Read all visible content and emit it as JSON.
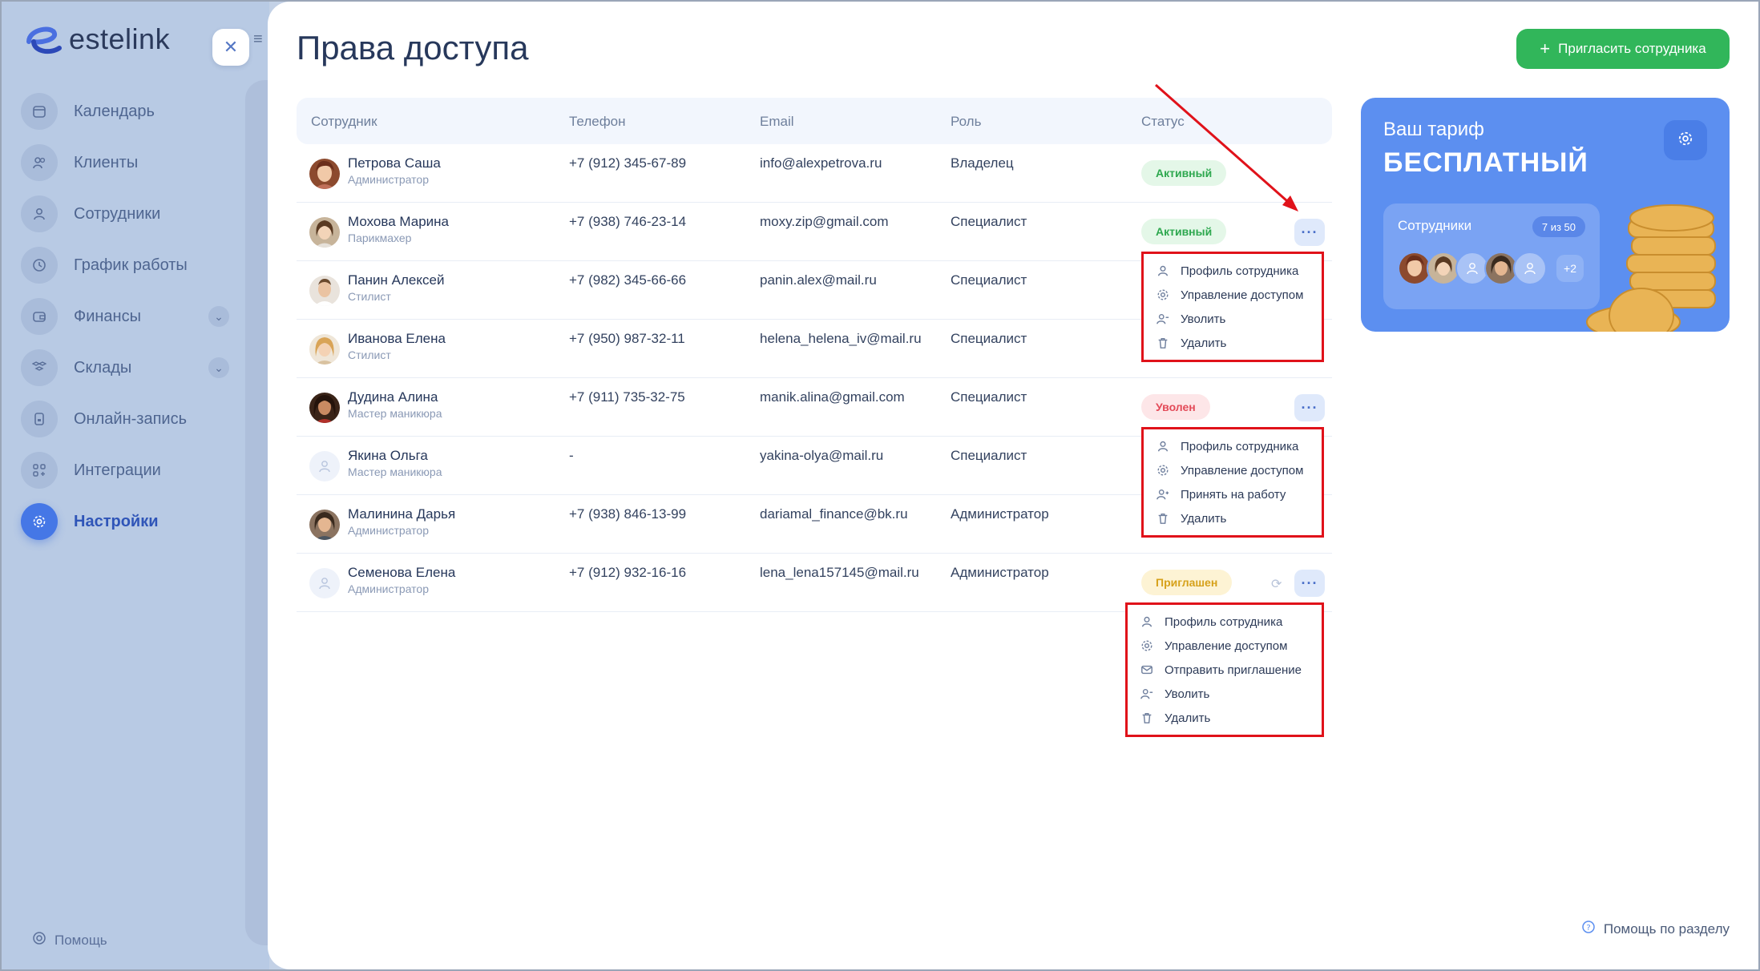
{
  "brand": {
    "name": "estelink"
  },
  "sidebar": {
    "items": [
      {
        "label": "Календарь",
        "icon": "calendar-icon"
      },
      {
        "label": "Клиенты",
        "icon": "clients-icon"
      },
      {
        "label": "Сотрудники",
        "icon": "user-icon"
      },
      {
        "label": "График работы",
        "icon": "clock-icon"
      },
      {
        "label": "Финансы",
        "icon": "wallet-icon",
        "expandable": true
      },
      {
        "label": "Склады",
        "icon": "boxes-icon",
        "expandable": true
      },
      {
        "label": "Онлайн-запись",
        "icon": "phone-icon"
      },
      {
        "label": "Интеграции",
        "icon": "integrations-icon"
      },
      {
        "label": "Настройки",
        "icon": "gear-icon",
        "active": true
      }
    ],
    "help": "Помощь"
  },
  "page": {
    "title": "Права доступа",
    "invite_button": "Пригласить сотрудника",
    "help_section": "Помощь по разделу"
  },
  "table": {
    "headers": {
      "employee": "Сотрудник",
      "phone": "Телефон",
      "email": "Email",
      "role": "Роль",
      "status": "Статус"
    },
    "rows": [
      {
        "name": "Петрова Саша",
        "position": "Администратор",
        "phone": "+7 (912) 345-67-89",
        "email": "info@alexpetrova.ru",
        "role": "Владелец",
        "status": "Активный",
        "status_type": "active"
      },
      {
        "name": "Мохова Марина",
        "position": "Парикмахер",
        "phone": "+7 (938) 746-23-14",
        "email": "moxy.zip@gmail.com",
        "role": "Специалист",
        "status": "Активный",
        "status_type": "active"
      },
      {
        "name": "Панин Алексей",
        "position": "Стилист",
        "phone": "+7 (982) 345-66-66",
        "email": "panin.alex@mail.ru",
        "role": "Специалист",
        "status": "",
        "status_type": ""
      },
      {
        "name": "Иванова Елена",
        "position": "Стилист",
        "phone": "+7 (950) 987-32-11",
        "email": "helena_helena_iv@mail.ru",
        "role": "Специалист",
        "status": "",
        "status_type": ""
      },
      {
        "name": "Дудина Алина",
        "position": "Мастер маникюра",
        "phone": "+7 (911) 735-32-75",
        "email": "manik.alina@gmail.com",
        "role": "Специалист",
        "status": "Уволен",
        "status_type": "fired"
      },
      {
        "name": "Якина Ольга",
        "position": "Мастер маникюра",
        "phone": "-",
        "email": "yakina-olya@mail.ru",
        "role": "Специалист",
        "status": "",
        "status_type": ""
      },
      {
        "name": "Малинина Дарья",
        "position": "Администратор",
        "phone": "+7 (938) 846-13-99",
        "email": "dariamal_finance@bk.ru",
        "role": "Администратор",
        "status": "",
        "status_type": ""
      },
      {
        "name": "Семенова Елена",
        "position": "Администратор",
        "phone": "+7 (912) 932-16-16",
        "email": "lena_lena157145@mail.ru",
        "role": "Администратор",
        "status": "Приглашен",
        "status_type": "invited"
      }
    ]
  },
  "menus": {
    "active": [
      {
        "label": "Профиль сотрудника",
        "icon": "user-icon"
      },
      {
        "label": "Управление доступом",
        "icon": "gear-icon"
      },
      {
        "label": "Уволить",
        "icon": "user-minus-icon"
      },
      {
        "label": "Удалить",
        "icon": "trash-icon"
      }
    ],
    "fired": [
      {
        "label": "Профиль сотрудника",
        "icon": "user-icon"
      },
      {
        "label": "Управление доступом",
        "icon": "gear-icon"
      },
      {
        "label": "Принять на работу",
        "icon": "user-plus-icon"
      },
      {
        "label": "Удалить",
        "icon": "trash-icon"
      }
    ],
    "invited": [
      {
        "label": "Профиль сотрудника",
        "icon": "user-icon"
      },
      {
        "label": "Управление доступом",
        "icon": "gear-icon"
      },
      {
        "label": "Отправить приглашение",
        "icon": "mail-icon"
      },
      {
        "label": "Уволить",
        "icon": "user-minus-icon"
      },
      {
        "label": "Удалить",
        "icon": "trash-icon"
      }
    ]
  },
  "tariff": {
    "label": "Ваш тариф",
    "plan": "БЕСПЛАТНЫЙ",
    "employees_label": "Сотрудники",
    "employees_count": "7 из 50",
    "more": "+2"
  },
  "colors": {
    "accent": "#4577e6",
    "invite": "#31b65a",
    "annotation": "#e0121a",
    "tariff": "#5c8ff0"
  }
}
